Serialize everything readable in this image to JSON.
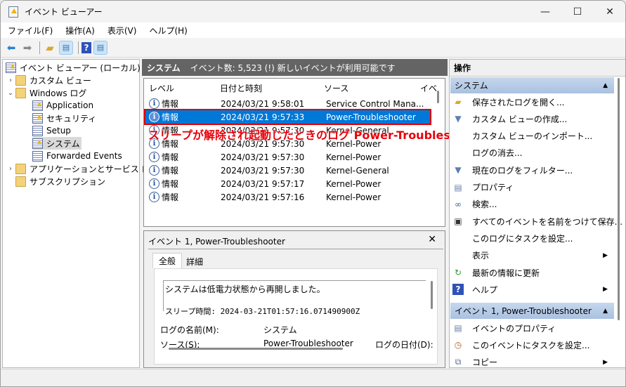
{
  "window": {
    "title": "イベント ビューアー",
    "controls": {
      "minimize": "—",
      "maximize": "☐",
      "close": "✕"
    }
  },
  "menu": [
    "ファイル(F)",
    "操作(A)",
    "表示(V)",
    "ヘルプ(H)"
  ],
  "toolbar": {
    "icons": [
      "back-arrow-icon",
      "forward-arrow-icon",
      "open-folder-icon",
      "show-hide-tree-icon",
      "help-icon",
      "show-hide-action-pane-icon"
    ]
  },
  "tree": {
    "root": "イベント ビューアー (ローカル)",
    "items": [
      {
        "label": "カスタム ビュー",
        "expander": "›"
      },
      {
        "label": "Windows ログ",
        "expander": "⌄"
      },
      {
        "label": "Application"
      },
      {
        "label": "セキュリティ"
      },
      {
        "label": "Setup"
      },
      {
        "label": "システム",
        "selected": true
      },
      {
        "label": "Forwarded Events"
      },
      {
        "label": "アプリケーションとサービス ログ",
        "expander": "›"
      },
      {
        "label": "サブスクリプション"
      }
    ]
  },
  "center": {
    "header_title": "システム",
    "header_status": "イベント数: 5,523 (!) 新しいイベントが利用可能です",
    "columns": [
      "レベル",
      "日付と時刻",
      "ソース",
      "イベ"
    ],
    "rows": [
      {
        "level": "情報",
        "datetime": "2024/03/21 9:58:01",
        "source": "Service Control Mana..."
      },
      {
        "level": "情報",
        "datetime": "2024/03/21 9:57:33",
        "source": "Power-Troubleshooter",
        "selected": true
      },
      {
        "level": "情報",
        "datetime": "2024/03/21 9:57:30",
        "source": "Kernel-General"
      },
      {
        "level": "情報",
        "datetime": "2024/03/21 9:57:30",
        "source": "Kernel-Power"
      },
      {
        "level": "情報",
        "datetime": "2024/03/21 9:57:30",
        "source": "Kernel-Power"
      },
      {
        "level": "情報",
        "datetime": "2024/03/21 9:57:30",
        "source": "Kernel-General"
      },
      {
        "level": "情報",
        "datetime": "2024/03/21 9:57:17",
        "source": "Kernel-Power"
      },
      {
        "level": "情報",
        "datetime": "2024/03/21 9:57:16",
        "source": "Kernel-Power"
      }
    ],
    "annotation": "スリープが解除され起動じたときのログ Power-Troubleshooter",
    "annotation_color": "#e8000a"
  },
  "detail": {
    "title": "イベント 1, Power-Troubleshooter",
    "close": "✕",
    "tabs": [
      "全般",
      "詳細"
    ],
    "message_line1": "システムは低電力状態から再開しました。",
    "message_line2": "スリープ時間: 2024-03-21T01:57:16.071490900Z",
    "fields": {
      "log_name_label": "ログの名前(M):",
      "log_name_value": "システム",
      "source_label": "ソース(S):",
      "source_value": "Power-Troubleshooter",
      "logged_label": "ログの日付(D):"
    }
  },
  "actions": {
    "header": "操作",
    "section1": {
      "title": "システム",
      "items": [
        {
          "label": "保存されたログを開く...",
          "icon": "open-folder-icon"
        },
        {
          "label": "カスタム ビューの作成...",
          "icon": "filter-icon"
        },
        {
          "label": "カスタム ビューのインポート...",
          "icon": ""
        },
        {
          "label": "ログの消去...",
          "icon": ""
        },
        {
          "label": "現在のログをフィルター...",
          "icon": "filter-icon"
        },
        {
          "label": "プロパティ",
          "icon": "properties-icon"
        },
        {
          "label": "検索...",
          "icon": "binoculars-icon"
        },
        {
          "label": "すべてのイベントを名前をつけて保存...",
          "icon": "save-icon"
        },
        {
          "label": "このログにタスクを設定...",
          "icon": ""
        },
        {
          "label": "表示",
          "icon": "",
          "submenu": true
        },
        {
          "label": "最新の情報に更新",
          "icon": "refresh-icon"
        },
        {
          "label": "ヘルプ",
          "icon": "help-icon",
          "submenu": true
        }
      ]
    },
    "section2": {
      "title": "イベント 1, Power-Troubleshooter",
      "items": [
        {
          "label": "イベントのプロパティ",
          "icon": "properties-icon"
        },
        {
          "label": "このイベントにタスクを設定...",
          "icon": "task-icon"
        },
        {
          "label": "コピー",
          "icon": "copy-icon",
          "submenu": true
        }
      ]
    }
  },
  "colors": {
    "selection": "#0078d7",
    "highlight_border": "#e00000",
    "center_header": "#646464",
    "section_header": "#b8cde8"
  }
}
